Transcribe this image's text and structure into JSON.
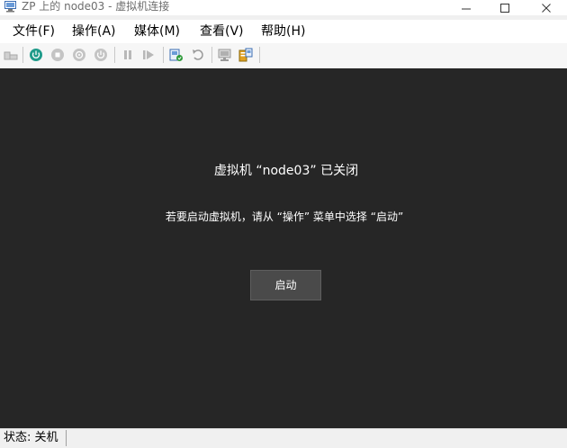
{
  "window": {
    "title": "ZP 上的 node03 - 虚拟机连接"
  },
  "menu": {
    "file": "文件(F)",
    "action": "操作(A)",
    "media": "媒体(M)",
    "view": "查看(V)",
    "help": "帮助(H)"
  },
  "toolbar": {
    "icons": [
      "ctrl-alt-del-icon",
      "start-icon",
      "turn-off-icon",
      "shut-down-icon",
      "save-icon",
      "pause-icon",
      "resume-icon",
      "checkpoint-icon",
      "revert-icon",
      "enhanced-session-icon",
      "share-icon"
    ]
  },
  "main": {
    "title": "虚拟机 “node03” 已关闭",
    "instruction": "若要启动虚拟机，请从 “操作” 菜单中选择 “启动”",
    "start_button": "启动"
  },
  "status": {
    "text": "状态: 关机"
  },
  "colors": {
    "main_background": "#262626",
    "button_background": "#4a4a4a",
    "start_icon": "#1f9b8a"
  }
}
